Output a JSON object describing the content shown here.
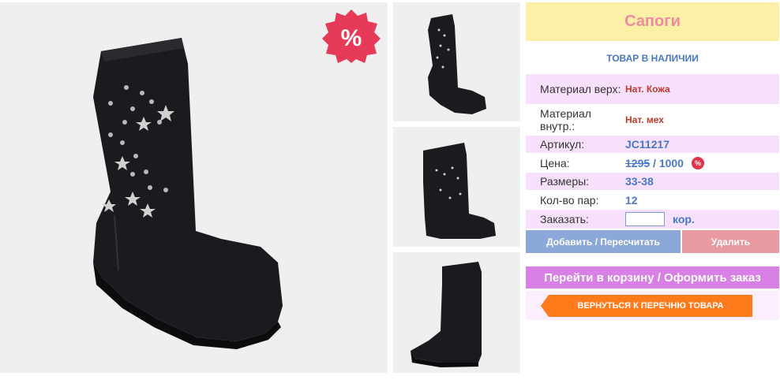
{
  "badge": {
    "symbol": "%"
  },
  "product": {
    "title": "Сапоги",
    "stock": "ТОВАР В НАЛИЧИИ",
    "specs": [
      {
        "label": "Материал верх:",
        "value": "Нат. Кожа"
      },
      {
        "label": "Материал внутр.:",
        "value": "Нат. мех"
      },
      {
        "label": "Артикул:",
        "value": "JC11217"
      }
    ],
    "price": {
      "label": "Цена:",
      "old": "1295",
      "separator": " / ",
      "new": "1000",
      "badge": "%"
    },
    "sizes": {
      "label": "Размеры:",
      "value": "33-38"
    },
    "pairs": {
      "label": "Кол-во пар:",
      "value": "12"
    },
    "order": {
      "label": "Заказать:",
      "input_value": "",
      "unit": "кор."
    }
  },
  "actions": {
    "add": "Добавить / Пересчитать",
    "delete": "Удалить",
    "cart": "Перейти в корзину / Оформить заказ",
    "back": "ВЕРНУТЬСЯ К ПЕРЕЧНЮ ТОВАРА"
  },
  "colors": {
    "title_bg": "#fbf0a6",
    "title_text": "#f08aa0",
    "accent_blue": "#4a78c8",
    "row_pink": "#f7e0fb",
    "add_button": "#8ca8d8",
    "delete_button": "#e99aa0",
    "cart_button": "#d880e6",
    "back_button": "#ff7a1a"
  },
  "images": {
    "main": "boot-main-photo",
    "thumbnails": [
      "boot-thumbnail-1",
      "boot-thumbnail-2",
      "boot-thumbnail-3"
    ]
  }
}
